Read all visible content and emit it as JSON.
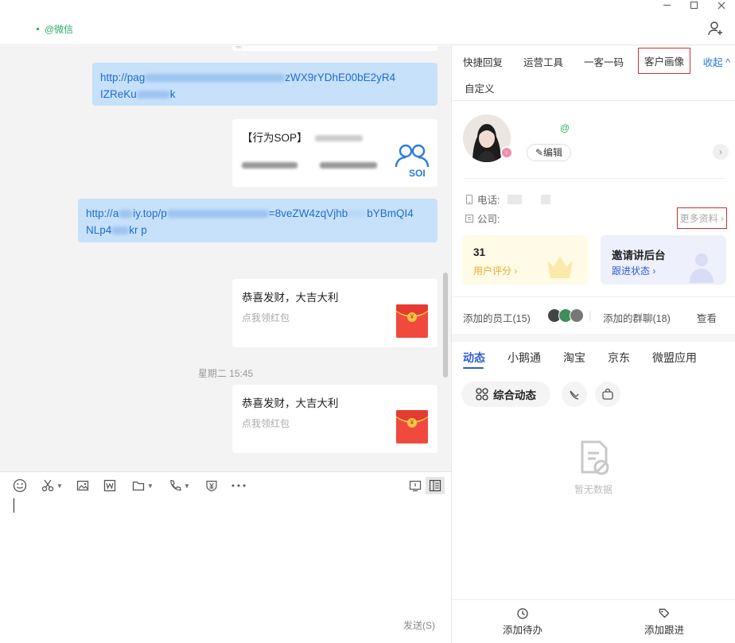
{
  "window": {
    "contact_suffix": "@微信"
  },
  "chat": {
    "messages": [
      {
        "type": "link",
        "text_start": "http://pag",
        "text_mid": "zWX9rYDhE00bE2yR4",
        "text_line2": "IZReKu",
        "text_tail": "k"
      },
      {
        "type": "card",
        "title": "【行为SOP】",
        "logo_text": "SOI"
      },
      {
        "type": "link",
        "text_start": "http://a",
        "text_mid": "iy.top/p",
        "text_mid2": "=8veZW4zqVjhb",
        "text_end": "bYBmQI4",
        "text_line2": "NLp4",
        "text_tail": "kr   p"
      },
      {
        "type": "redpacket",
        "title": "恭喜发财，大吉大利",
        "sub": "点我领红包"
      },
      {
        "type": "redpacket",
        "title": "恭喜发财，大吉大利",
        "sub": "点我领红包"
      }
    ],
    "timestamp": "星期二 15:45"
  },
  "composer": {
    "send_label": "发送(S)"
  },
  "panel": {
    "tabs": [
      "快捷回复",
      "运营工具",
      "一客一码",
      "客户画像"
    ],
    "active_tab": "客户画像",
    "collapse_label": "收起",
    "custom_tab": "自定义",
    "profile": {
      "nick_suffix": "@",
      "edit_label": "编辑",
      "phone_label": "电话:",
      "company_label": "公司:",
      "more_label": "更多资料"
    },
    "stats": {
      "score_value": "31",
      "score_label": "用户评分",
      "invite_title": "邀请讲后台",
      "invite_label": "跟进状态"
    },
    "staff": {
      "added_staff": "添加的员工(15)",
      "added_groups": "添加的群聊(18)",
      "view_label": "查看"
    },
    "dynamic_tabs": [
      "动态",
      "小鹅通",
      "淘宝",
      "京东",
      "微盟应用"
    ],
    "active_dynamic_tab": "动态",
    "pill_label": "综合动态",
    "empty_label": "暂无数据",
    "bottom": {
      "todo_label": "添加待办",
      "followup_label": "添加跟进"
    }
  },
  "colors": {
    "accent_blue": "#2a5cd6",
    "link_bubble": "#c7e1fb",
    "wechat_green": "#2aae67",
    "highlight_red": "#d03030",
    "redpacket": "#f04a3f"
  }
}
